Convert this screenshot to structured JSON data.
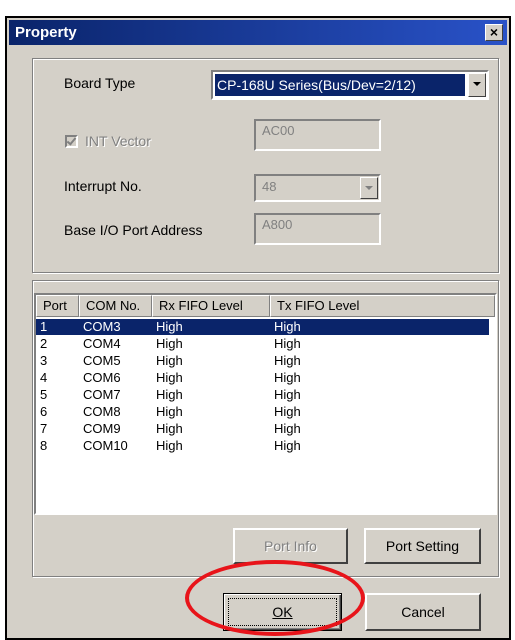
{
  "window": {
    "title": "Property",
    "close_glyph": "×"
  },
  "board": {
    "board_type_label": "Board Type",
    "board_type_value": "CP-168U Series(Bus/Dev=2/12)",
    "int_vector_label": "INT Vector",
    "int_vector_checked": true,
    "int_vector_value": "AC00",
    "interrupt_label": "Interrupt No.",
    "interrupt_value": "48",
    "base_io_label": "Base I/O Port Address",
    "base_io_value": "A800"
  },
  "ports": {
    "headers": [
      "Port",
      "COM No.",
      "Rx FIFO Level",
      "Tx FIFO Level"
    ],
    "rows": [
      {
        "port": "1",
        "com": "COM3",
        "rx": "High",
        "tx": "High",
        "selected": true
      },
      {
        "port": "2",
        "com": "COM4",
        "rx": "High",
        "tx": "High"
      },
      {
        "port": "3",
        "com": "COM5",
        "rx": "High",
        "tx": "High"
      },
      {
        "port": "4",
        "com": "COM6",
        "rx": "High",
        "tx": "High"
      },
      {
        "port": "5",
        "com": "COM7",
        "rx": "High",
        "tx": "High"
      },
      {
        "port": "6",
        "com": "COM8",
        "rx": "High",
        "tx": "High"
      },
      {
        "port": "7",
        "com": "COM9",
        "rx": "High",
        "tx": "High"
      },
      {
        "port": "8",
        "com": "COM10",
        "rx": "High",
        "tx": "High"
      }
    ],
    "port_info_label": "Port Info",
    "port_setting_label": "Port Setting"
  },
  "footer": {
    "ok_label": "OK",
    "cancel_label": "Cancel"
  },
  "colors": {
    "selection": "#0a246a",
    "dialog": "#d4d0c8",
    "highlight_ring": "#e8141a"
  }
}
